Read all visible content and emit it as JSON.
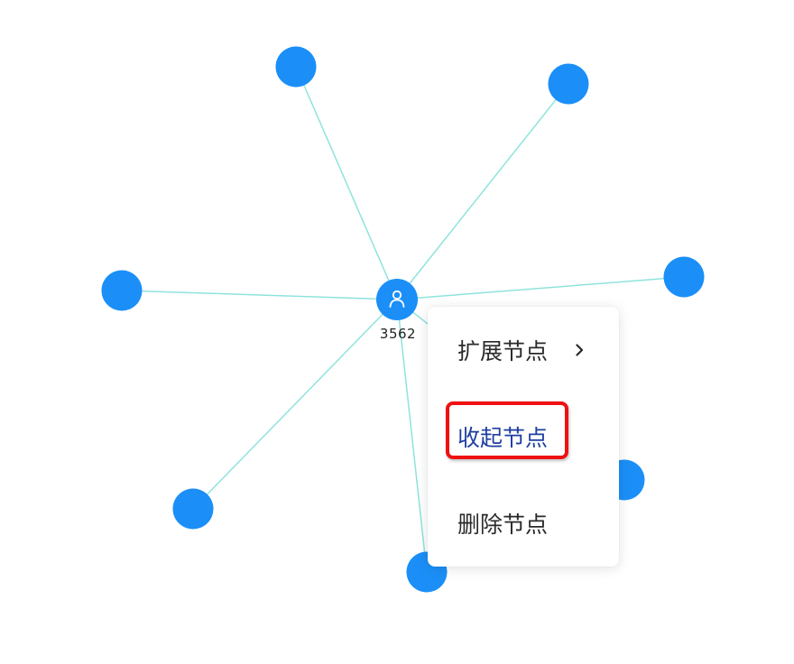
{
  "graph": {
    "center_node": {
      "label": "3562",
      "icon": "user-icon"
    },
    "leaf_node_count": 8
  },
  "context_menu": {
    "items": [
      {
        "label": "扩展节点",
        "has_submenu": true,
        "submenu_icon": "chevron-right-icon"
      },
      {
        "label": "收起节点",
        "has_submenu": false,
        "highlighted": true
      },
      {
        "label": "删除节点",
        "has_submenu": false
      }
    ]
  },
  "colors": {
    "node": "#1b8ff7",
    "edge": "#8fe3dd",
    "highlight_border": "#ee1111",
    "active_menu_text": "#1f3f9f"
  }
}
